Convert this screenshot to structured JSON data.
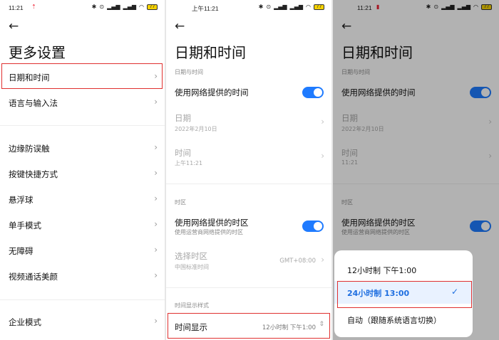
{
  "panel1": {
    "status": {
      "time": "11:21",
      "battery": "77"
    },
    "title": "更多设置",
    "items": [
      {
        "label": "日期和时间"
      },
      {
        "label": "语言与输入法"
      },
      {
        "label": "边缘防误触"
      },
      {
        "label": "按键快捷方式"
      },
      {
        "label": "悬浮球"
      },
      {
        "label": "单手模式"
      },
      {
        "label": "无障碍"
      },
      {
        "label": "视频通话美颜"
      },
      {
        "label": "企业模式"
      }
    ]
  },
  "panel2": {
    "status": {
      "time": "上午11:21",
      "battery": "77"
    },
    "title": "日期和时间",
    "section_datetime": "日期与时间",
    "network_time": {
      "label": "使用网络提供的时间",
      "enabled": true
    },
    "date": {
      "label": "日期",
      "value": "2022年2月10日"
    },
    "time": {
      "label": "时间",
      "value": "上午11:21"
    },
    "section_timezone": "时区",
    "network_tz": {
      "label": "使用网络提供的时区",
      "sub": "使用运营商网络提供的时区",
      "enabled": true
    },
    "select_tz": {
      "label": "选择时区",
      "sub": "中国标准时间",
      "value": "GMT+08:00"
    },
    "section_format": "时间显示样式",
    "time_display": {
      "label": "时间显示",
      "value": "12小时制 下午1:00"
    }
  },
  "panel3": {
    "status": {
      "time": "11:21",
      "battery": "77"
    },
    "title": "日期和时间",
    "section_datetime": "日期与时间",
    "network_time": {
      "label": "使用网络提供的时间",
      "enabled": true
    },
    "date": {
      "label": "日期",
      "value": "2022年2月10日"
    },
    "time": {
      "label": "时间",
      "value": "11:21"
    },
    "section_timezone": "时区",
    "network_tz": {
      "label": "使用网络提供的时区",
      "sub": "使用运营商网络提供的时区",
      "enabled": true
    },
    "options": [
      {
        "label": "12小时制 下午1:00",
        "selected": false
      },
      {
        "label": "24小时制 13:00",
        "selected": true
      },
      {
        "label": "自动（跟随系统语言切换）",
        "selected": false
      }
    ]
  },
  "colors": {
    "accent": "#1f7bff",
    "highlight": "#e0302f"
  }
}
